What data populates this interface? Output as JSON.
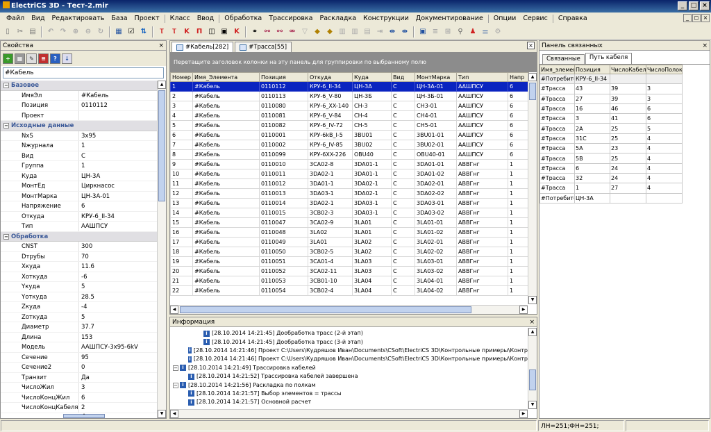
{
  "window": {
    "title": "ElectriCS 3D - Тест-2.mir"
  },
  "menu": [
    "Файл",
    "Вид",
    "Редактировать",
    "База",
    "Проект",
    "Класс",
    "Ввод",
    "Обработка",
    "Трассировка",
    "Раскладка",
    "Конструкции",
    "Документирование",
    "Опции",
    "Сервис",
    "Справка"
  ],
  "properties": {
    "title": "Свойства",
    "filter_value": "#Кабель",
    "categories": [
      {
        "name": "Базовое",
        "rows": [
          [
            "ИмяЭл",
            "#Кабель"
          ],
          [
            "Позиция",
            "0110112"
          ],
          [
            "Проект",
            ""
          ]
        ]
      },
      {
        "name": "Исходные данные",
        "rows": [
          [
            "NxS",
            "3x95"
          ],
          [
            "Nжурнала",
            "1"
          ],
          [
            "Вид",
            "С"
          ],
          [
            "Группа",
            "1"
          ],
          [
            "Куда",
            "ЦН-3А"
          ],
          [
            "МонтЕд",
            "Циркнасос"
          ],
          [
            "МонтМарка",
            "ЦН-3А-01"
          ],
          [
            "Напряжение",
            "6"
          ],
          [
            "Откуда",
            "КРУ-6_II-34"
          ],
          [
            "Тип",
            "ААШПСУ"
          ]
        ]
      },
      {
        "name": "Обработка",
        "rows": [
          [
            "CNST",
            "300"
          ],
          [
            "Dтрубы",
            "70"
          ],
          [
            "Xкуда",
            "11.6"
          ],
          [
            "Xоткуда",
            "-6"
          ],
          [
            "Yкуда",
            "5"
          ],
          [
            "Yоткуда",
            "28.5"
          ],
          [
            "Zкуда",
            "-4"
          ],
          [
            "Zоткуда",
            "5"
          ],
          [
            "Диаметр",
            "37.7"
          ],
          [
            "Длина",
            "153"
          ],
          [
            "Модель",
            "ААШПСУ-3x95-6kV"
          ],
          [
            "Сечение",
            "95"
          ],
          [
            "Сечение2",
            "0"
          ],
          [
            "Транзит",
            "Да"
          ],
          [
            "ЧислоЖил",
            "3"
          ],
          [
            "ЧислоКонцЖил",
            "6"
          ],
          [
            "ЧислоКонцКабеля",
            "2"
          ]
        ]
      }
    ]
  },
  "grid": {
    "tabs": [
      "#Кабель[282]",
      "#Трасса[55]"
    ],
    "group_hint": "Перетащите заголовок колонки на эту панель для группировки по выбранному полю",
    "columns": [
      "Номер",
      "Имя_Элемента",
      "Позиция",
      "Откуда",
      "Куда",
      "Вид",
      "МонтМарка",
      "Тип",
      "Напр"
    ],
    "rows": [
      [
        "1",
        "#Кабель",
        "0110112",
        "КРУ-6_II-34",
        "ЦН-3А",
        "С",
        "ЦН-3А-01",
        "ААШПСУ",
        "6"
      ],
      [
        "2",
        "#Кабель",
        "0110113",
        "КРУ-6_V-80",
        "ЦН-3Б",
        "С",
        "ЦН-3Б-01",
        "ААШПСУ",
        "6"
      ],
      [
        "3",
        "#Кабель",
        "0110080",
        "КРУ-6_XX-140",
        "CH-3",
        "С",
        "CH3-01",
        "ААШПСУ",
        "6"
      ],
      [
        "4",
        "#Кабель",
        "0110081",
        "КРУ-6_V-84",
        "CH-4",
        "С",
        "CH4-01",
        "ААШПСУ",
        "6"
      ],
      [
        "5",
        "#Кабель",
        "0110082",
        "КРУ-6_IV-72",
        "CH-5",
        "С",
        "CH5-01",
        "ААШПСУ",
        "6"
      ],
      [
        "6",
        "#Кабель",
        "0110001",
        "КРУ-6kB_I-5",
        "3BU01",
        "С",
        "3BU01-01",
        "ААШПСУ",
        "6"
      ],
      [
        "7",
        "#Кабель",
        "0110002",
        "КРУ-6_IV-85",
        "3BU02",
        "С",
        "3BU02-01",
        "ААШПСУ",
        "6"
      ],
      [
        "8",
        "#Кабель",
        "0110099",
        "КРУ-6XX-226",
        "OBU40",
        "С",
        "OBU40-01",
        "ААШПСУ",
        "6"
      ],
      [
        "9",
        "#Кабель",
        "0110010",
        "3СА02-8",
        "3DA01-1",
        "С",
        "3DA01-01",
        "АВВГнг",
        "1"
      ],
      [
        "10",
        "#Кабель",
        "0110011",
        "3DA02-1",
        "3DA01-1",
        "С",
        "3DA01-02",
        "АВВГнг",
        "1"
      ],
      [
        "11",
        "#Кабель",
        "0110012",
        "3DA01-1",
        "3DA02-1",
        "С",
        "3DA02-01",
        "АВВГнг",
        "1"
      ],
      [
        "12",
        "#Кабель",
        "0110013",
        "3DA03-1",
        "3DA02-1",
        "С",
        "3DA02-02",
        "АВВГнг",
        "1"
      ],
      [
        "13",
        "#Кабель",
        "0110014",
        "3DA02-1",
        "3DA03-1",
        "С",
        "3DA03-01",
        "АВВГнг",
        "1"
      ],
      [
        "14",
        "#Кабель",
        "0110015",
        "3СВ02-3",
        "3DA03-1",
        "С",
        "3DA03-02",
        "АВВГнг",
        "1"
      ],
      [
        "15",
        "#Кабель",
        "0110047",
        "3СА02-9",
        "3LA01",
        "С",
        "3LA01-01",
        "АВВГнг",
        "1"
      ],
      [
        "16",
        "#Кабель",
        "0110048",
        "3LA02",
        "3LA01",
        "С",
        "3LA01-02",
        "АВВГнг",
        "1"
      ],
      [
        "17",
        "#Кабель",
        "0110049",
        "3LA01",
        "3LA02",
        "С",
        "3LA02-01",
        "АВВГнг",
        "1"
      ],
      [
        "18",
        "#Кабель",
        "0110050",
        "3СВ02-5",
        "3LA02",
        "С",
        "3LA02-02",
        "АВВГнг",
        "1"
      ],
      [
        "19",
        "#Кабель",
        "0110051",
        "3СА01-4",
        "3LA03",
        "С",
        "3LA03-01",
        "АВВГнг",
        "1"
      ],
      [
        "20",
        "#Кабель",
        "0110052",
        "3СА02-11",
        "3LA03",
        "С",
        "3LA03-02",
        "АВВГнг",
        "1"
      ],
      [
        "21",
        "#Кабель",
        "0110053",
        "3СВ01-10",
        "3LA04",
        "С",
        "3LA04-01",
        "АВВГнг",
        "1"
      ],
      [
        "22",
        "#Кабель",
        "0110054",
        "3СВ02-4",
        "3LA04",
        "С",
        "3LA04-02",
        "АВВГнг",
        "1"
      ]
    ]
  },
  "info": {
    "title": "Информация",
    "lines": [
      {
        "indent": 2,
        "text": "[28.10.2014 14:21:45] Дообработка трасс (2-й этап)"
      },
      {
        "indent": 2,
        "text": "[28.10.2014 14:21:45] Дообработка трасс (3-й этап)"
      },
      {
        "indent": 1,
        "text": "[28.10.2014 14:21:46] Проект C:\\Users\\Кудряшов Иван\\Documents\\CSoft\\ElectriCS 3D\\Контрольные примеры\\Контр"
      },
      {
        "indent": 1,
        "text": "[28.10.2014 14:21:46] Проект C:\\Users\\Кудряшов Иван\\Documents\\CSoft\\ElectriCS 3D\\Контрольные примеры\\Контр"
      },
      {
        "indent": 0,
        "tree": true,
        "text": "[28.10.2014 14:21:49] Трассировка кабелей"
      },
      {
        "indent": 1,
        "text": "[28.10.2014 14:21:52] Трассировка кабелей завершена"
      },
      {
        "indent": 0,
        "tree": true,
        "text": "[28.10.2014 14:21:56] Раскладка по полкам"
      },
      {
        "indent": 1,
        "text": "[28.10.2014 14:21:57] Выбор элементов = трассы"
      },
      {
        "indent": 1,
        "text": "[28.10.2014 14:21:57] Основной расчет"
      }
    ]
  },
  "linked": {
    "title": "Панель связанных",
    "tabs": [
      "Связанные",
      "Путь кабеля"
    ],
    "columns": [
      "Имя_элемен",
      "Позиция",
      "ЧислоКабел",
      "ЧислоПолок"
    ],
    "rows": [
      [
        "#Потребите",
        "КРУ-6_II-34",
        "",
        ""
      ],
      [
        "#Трасса",
        "43",
        "39",
        "3"
      ],
      [
        "#Трасса",
        "27",
        "39",
        "3"
      ],
      [
        "#Трасса",
        "16",
        "46",
        "6"
      ],
      [
        "#Трасса",
        "3",
        "41",
        "6"
      ],
      [
        "#Трасса",
        "2А",
        "25",
        "5"
      ],
      [
        "#Трасса",
        "31С",
        "25",
        "4"
      ],
      [
        "#Трасса",
        "5А",
        "23",
        "4"
      ],
      [
        "#Трасса",
        "5В",
        "25",
        "4"
      ],
      [
        "#Трасса",
        "6",
        "24",
        "4"
      ],
      [
        "#Трасса",
        "32",
        "24",
        "4"
      ],
      [
        "#Трасса",
        "1",
        "27",
        "4"
      ],
      [
        "#Потребите",
        "ЦН-3А",
        "",
        ""
      ]
    ]
  },
  "status": {
    "counts": "ЛН=251;ФН=251;"
  }
}
